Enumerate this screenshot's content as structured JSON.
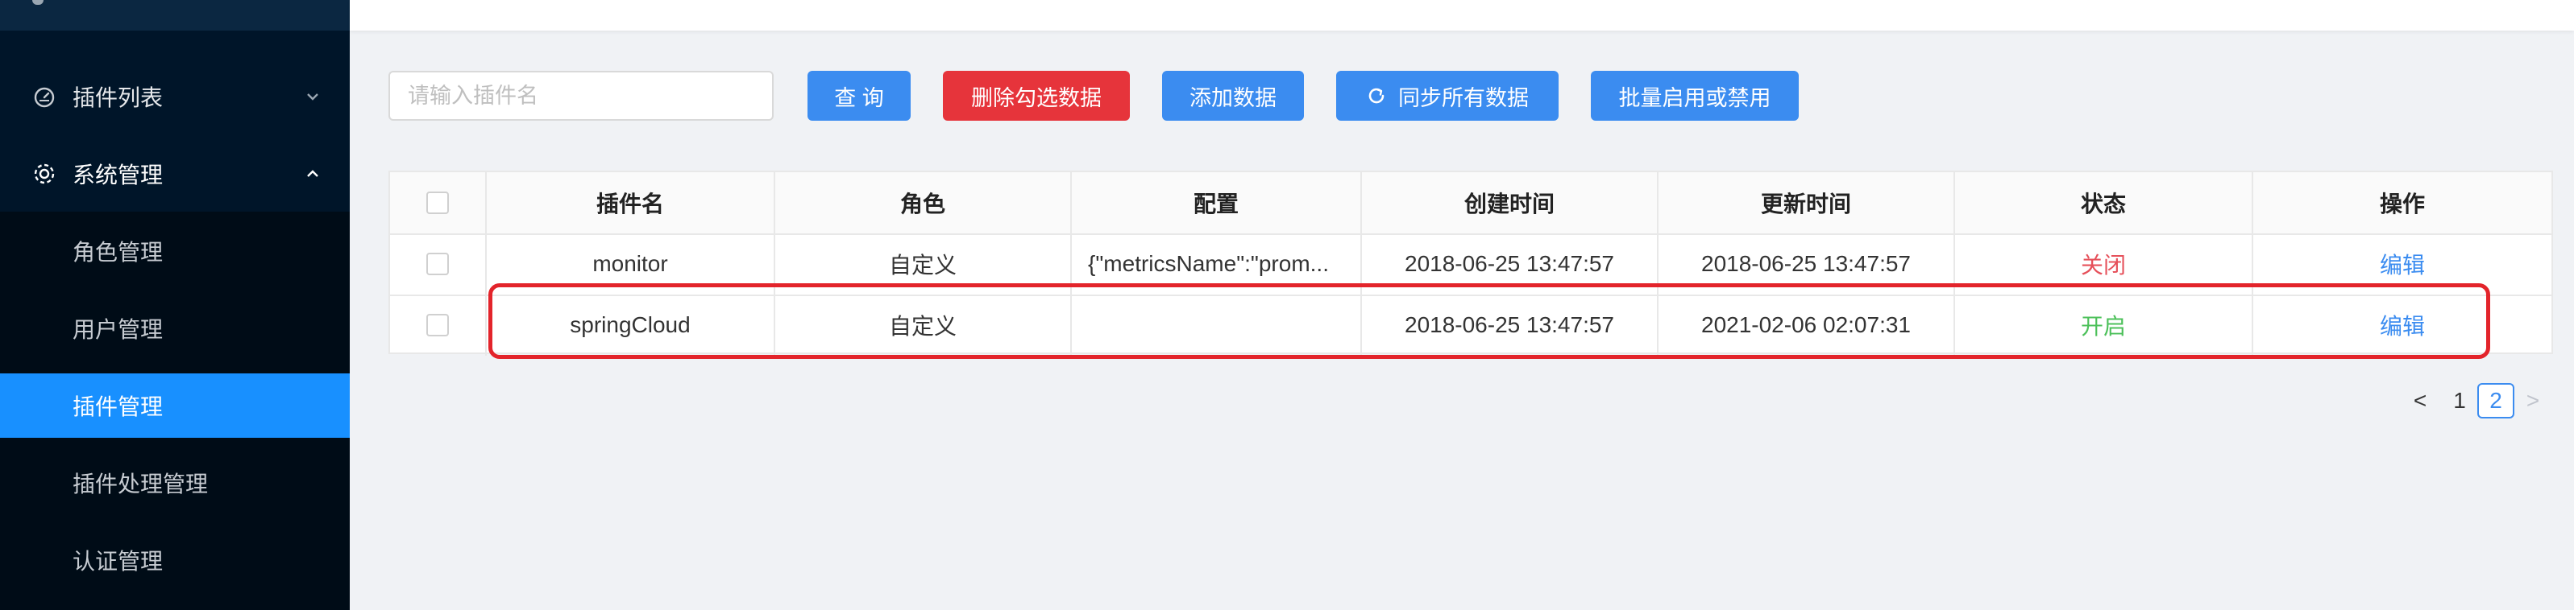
{
  "sidebar": {
    "menus": [
      {
        "label": "插件列表",
        "icon": "dashboard-icon",
        "expanded": false
      },
      {
        "label": "系统管理",
        "icon": "gear-icon",
        "expanded": true
      }
    ],
    "submenu": [
      {
        "label": "角色管理",
        "active": false
      },
      {
        "label": "用户管理",
        "active": false
      },
      {
        "label": "插件管理",
        "active": true
      },
      {
        "label": "插件处理管理",
        "active": false
      },
      {
        "label": "认证管理",
        "active": false
      }
    ]
  },
  "toolbar": {
    "search_placeholder": "请输入插件名",
    "query_label": "查 询",
    "delete_label": "删除勾选数据",
    "add_label": "添加数据",
    "sync_label": "同步所有数据",
    "batch_label": "批量启用或禁用"
  },
  "table": {
    "columns": [
      "插件名",
      "角色",
      "配置",
      "创建时间",
      "更新时间",
      "状态",
      "操作"
    ],
    "rows": [
      {
        "name": "monitor",
        "role": "自定义",
        "config": "{\"metricsName\":\"prom...",
        "created": "2018-06-25 13:47:57",
        "updated": "2018-06-25 13:47:57",
        "status": "关闭",
        "action": "编辑"
      },
      {
        "name": "springCloud",
        "role": "自定义",
        "config": "",
        "created": "2018-06-25 13:47:57",
        "updated": "2021-02-06 02:07:31",
        "status": "开启",
        "action": "编辑"
      }
    ]
  },
  "pagination": {
    "prev": "<",
    "pages": [
      "1",
      "2"
    ],
    "current": "2",
    "next": ">"
  },
  "colors": {
    "primary": "#3b8cf0",
    "danger": "#e6343b",
    "sidebar": "#001529",
    "active": "#1890ff",
    "closed": "#e6505a",
    "open": "#4cc05a",
    "highlight": "#e3242b"
  }
}
